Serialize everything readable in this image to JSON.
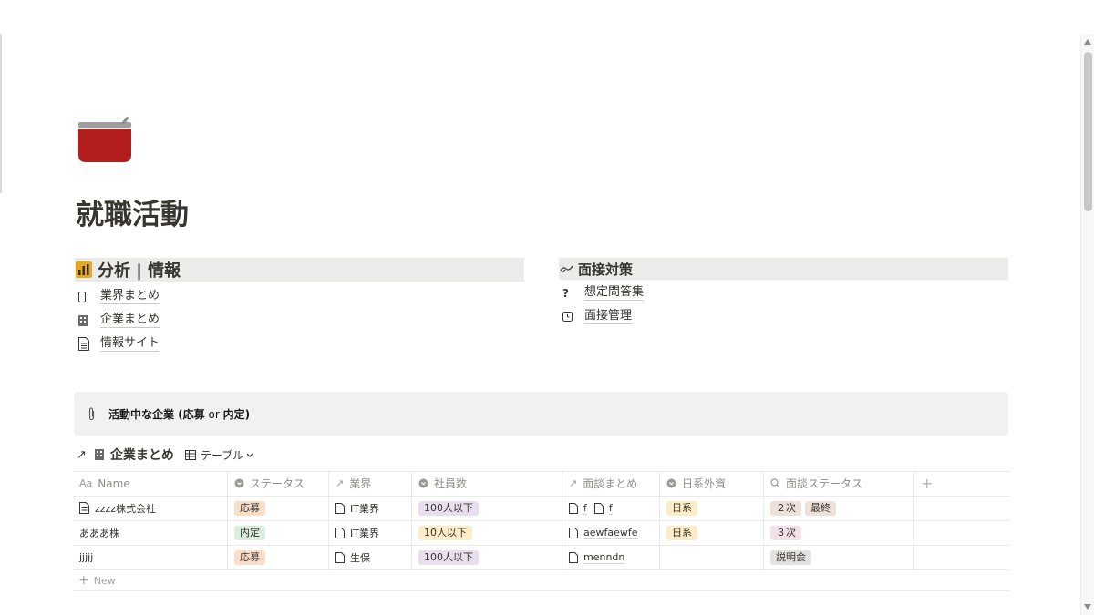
{
  "page": {
    "title": "就職活動",
    "icon": "cooking-pot-icon"
  },
  "columns": [
    {
      "heading": "分析 | 情報",
      "heading_icon": "bar-chart-icon",
      "links": [
        {
          "label": "業界まとめ",
          "icon": "phone-icon"
        },
        {
          "label": "企業まとめ",
          "icon": "building-icon"
        },
        {
          "label": "情報サイト",
          "icon": "document-icon"
        }
      ]
    },
    {
      "heading": "面接対策",
      "heading_icon": "handshake-icon",
      "links": [
        {
          "label": "想定問答集",
          "icon": "question-mark-icon"
        },
        {
          "label": "面接管理",
          "icon": "alarm-clock-icon"
        }
      ]
    }
  ],
  "callout": {
    "part1": "活動中な企業 (応募",
    "part2": " or ",
    "part3": "内定)",
    "icon": "paperclip-icon"
  },
  "database": {
    "link_arrow": "↗",
    "title": "企業まとめ",
    "view_label": "テーブル",
    "columns": [
      {
        "label": "Name",
        "icon": "Aa"
      },
      {
        "label": "ステータス",
        "icon": "select-icon"
      },
      {
        "label": "業界",
        "icon": "relation-icon"
      },
      {
        "label": "社員数",
        "icon": "select-icon"
      },
      {
        "label": "面談まとめ",
        "icon": "relation-icon"
      },
      {
        "label": "日系外資",
        "icon": "select-icon"
      },
      {
        "label": "面談ステータス",
        "icon": "search-icon"
      }
    ],
    "rows": [
      {
        "name": "zzzz株式会社",
        "status": "応募",
        "industry": "IT業界",
        "employees": "100人以下",
        "interview_notes": [
          "f",
          "f"
        ],
        "origin": "日系",
        "interview_status": [
          "２次",
          "最終"
        ]
      },
      {
        "name": "あああ株",
        "status": "内定",
        "industry": "IT業界",
        "employees": "10人以下",
        "interview_notes": [
          "aewfaewfe"
        ],
        "origin": "日系",
        "interview_status": [
          "３次"
        ]
      },
      {
        "name": "jjjjj",
        "status": "応募",
        "industry": "生保",
        "employees": "100人以下",
        "interview_notes": [
          "menndn"
        ],
        "origin": "",
        "interview_status": [
          "説明会"
        ]
      }
    ],
    "new_label": "New",
    "add_column_symbol": "+"
  },
  "colors": {
    "tag_orange": "#fadec9",
    "tag_green": "#dbeddb",
    "tag_purple": "#e8deee",
    "tag_yellow": "#fdecc8",
    "tag_brown": "#eee0da",
    "tag_pink": "#f5e0e9",
    "tag_gray": "#e3e2e0",
    "heading_bg": "#ebebea",
    "callout_bg": "#f1f1ef"
  }
}
